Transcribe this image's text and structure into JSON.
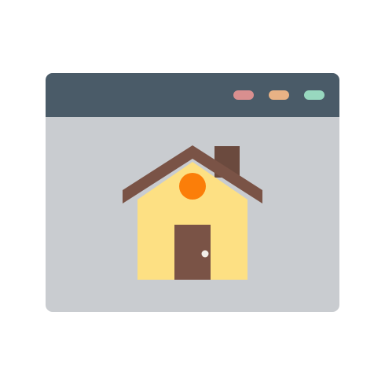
{
  "colors": {
    "page_background": "#ffffff",
    "window_body": "#c9ccd0",
    "titlebar": "#4a5b68",
    "dot_red": "#d98f8f",
    "dot_orange": "#e8b285",
    "dot_green": "#98d8bf",
    "house_wall": "#fde083",
    "house_roof": "#7a5346",
    "chimney": "#6b4a3e",
    "door": "#7a5346",
    "door_knob": "#f2efe9",
    "window_circle": "#fb7e09"
  },
  "icons": {
    "window_controls": [
      "close-dot-icon",
      "minimize-dot-icon",
      "maximize-dot-icon"
    ],
    "illustration": "house-icon"
  }
}
